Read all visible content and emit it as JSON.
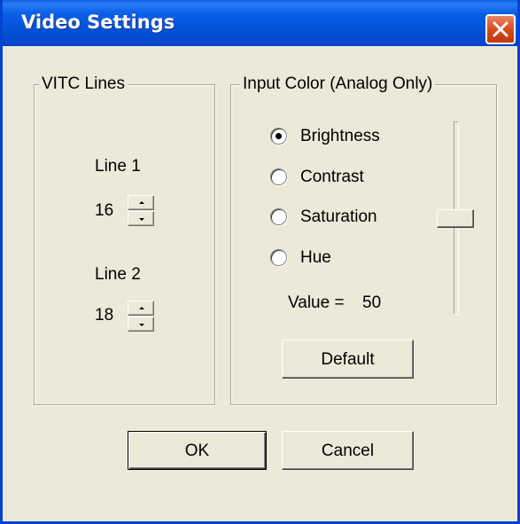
{
  "window": {
    "title": "Video Settings"
  },
  "vitc": {
    "group_label": "VITC Lines",
    "line1": {
      "label": "Line 1",
      "value": "16"
    },
    "line2": {
      "label": "Line 2",
      "value": "18"
    }
  },
  "input_color": {
    "group_label": "Input Color (Analog Only)",
    "options": [
      {
        "label": "Brightness",
        "selected": true
      },
      {
        "label": "Contrast",
        "selected": false
      },
      {
        "label": "Saturation",
        "selected": false
      },
      {
        "label": "Hue",
        "selected": false
      }
    ],
    "value_label": "Value =",
    "value": "50",
    "slider_level_percent": 50,
    "default_button": "Default"
  },
  "buttons": {
    "ok": "OK",
    "cancel": "Cancel"
  },
  "icons": {
    "close": "close-icon",
    "radio_selected": "radio-selected-icon"
  },
  "colors": {
    "titlebar": "#0350d6",
    "close_button": "#d84a1f",
    "dialog_bg": "#ece9d8"
  }
}
